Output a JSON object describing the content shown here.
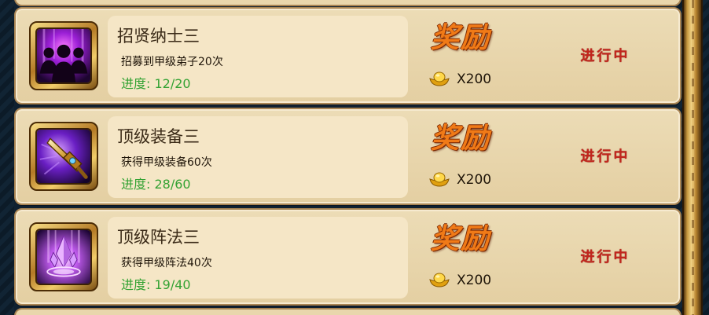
{
  "tasks": [
    {
      "title": "招贤纳士三",
      "description": "招募到甲级弟子20次",
      "progress_label": "进度: 12/20",
      "progress": {
        "current": 12,
        "total": 20
      },
      "icon": "silhouettes-icon",
      "reward_title": "奖励",
      "reward_icon": "gold-ingot-icon",
      "reward_amount": "X200",
      "status": "进行中"
    },
    {
      "title": "顶级装备三",
      "description": "获得甲级装备60次",
      "progress_label": "进度: 28/60",
      "progress": {
        "current": 28,
        "total": 60
      },
      "icon": "sword-icon",
      "reward_title": "奖励",
      "reward_icon": "gold-ingot-icon",
      "reward_amount": "X200",
      "status": "进行中"
    },
    {
      "title": "顶级阵法三",
      "description": "获得甲级阵法40次",
      "progress_label": "进度: 19/40",
      "progress": {
        "current": 19,
        "total": 40
      },
      "icon": "crystal-formation-icon",
      "reward_title": "奖励",
      "reward_icon": "gold-ingot-icon",
      "reward_amount": "X200",
      "status": "进行中"
    }
  ],
  "colors": {
    "progress_text": "#33a233",
    "status_text": "#c2261d",
    "reward_title": "#f07a17",
    "row_background": "#e4cfa2",
    "panel_background": "#f5e6c6"
  }
}
